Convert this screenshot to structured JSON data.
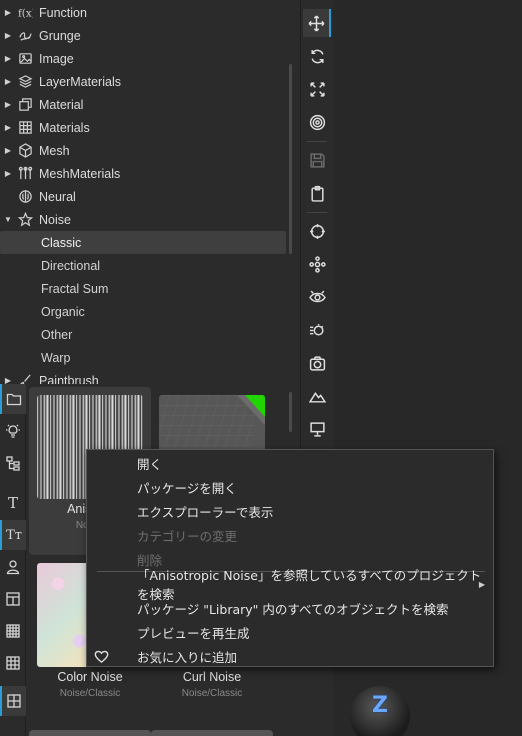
{
  "tree": {
    "items": [
      {
        "label": "Function",
        "icon": "function-icon",
        "expanded": false
      },
      {
        "label": "Grunge",
        "icon": "grunge-icon",
        "expanded": false
      },
      {
        "label": "Image",
        "icon": "image-icon",
        "expanded": false
      },
      {
        "label": "LayerMaterials",
        "icon": "layers-icon",
        "expanded": false
      },
      {
        "label": "Material",
        "icon": "material-icon",
        "expanded": false
      },
      {
        "label": "Materials",
        "icon": "materials-icon",
        "expanded": false
      },
      {
        "label": "Mesh",
        "icon": "cube-icon",
        "expanded": false
      },
      {
        "label": "MeshMaterials",
        "icon": "mesh-materials-icon",
        "expanded": false
      },
      {
        "label": "Neural",
        "icon": "brain-icon",
        "expanded": null
      },
      {
        "label": "Noise",
        "icon": "star-icon",
        "expanded": true
      }
    ],
    "noise_children": [
      "Classic",
      "Directional",
      "Fractal Sum",
      "Organic",
      "Other",
      "Warp"
    ],
    "selected_child": "Classic",
    "partial_item": "Paintbrush"
  },
  "library": {
    "items": [
      {
        "name": "Anisotro",
        "category": "Noise/"
      },
      {
        "name": "",
        "category": ""
      },
      {
        "name": "Color Noise",
        "category": "Noise/Classic"
      },
      {
        "name": "Curl Noise",
        "category": "Noise/Classic"
      }
    ]
  },
  "context_menu": {
    "items": [
      {
        "label": "開く",
        "disabled": false
      },
      {
        "label": "パッケージを開く",
        "disabled": false
      },
      {
        "label": "エクスプローラーで表示",
        "disabled": false
      },
      {
        "label": "カテゴリーの変更",
        "disabled": true
      },
      {
        "label": "削除",
        "disabled": true
      },
      {
        "label": "「Anisotropic Noise」を参照しているすべてのプロジェクトを検索",
        "disabled": false,
        "submenu": true
      },
      {
        "label": "パッケージ \"Library\" 内のすべてのオブジェクトを検索",
        "disabled": false
      },
      {
        "label": "プレビューを再生成",
        "disabled": false
      },
      {
        "label": "お気に入りに追加",
        "disabled": false,
        "icon": "heart-icon"
      }
    ]
  },
  "colors": {
    "accent": "#2a9fd6",
    "background": "#2b2b2b",
    "green_tag": "#22d400"
  }
}
